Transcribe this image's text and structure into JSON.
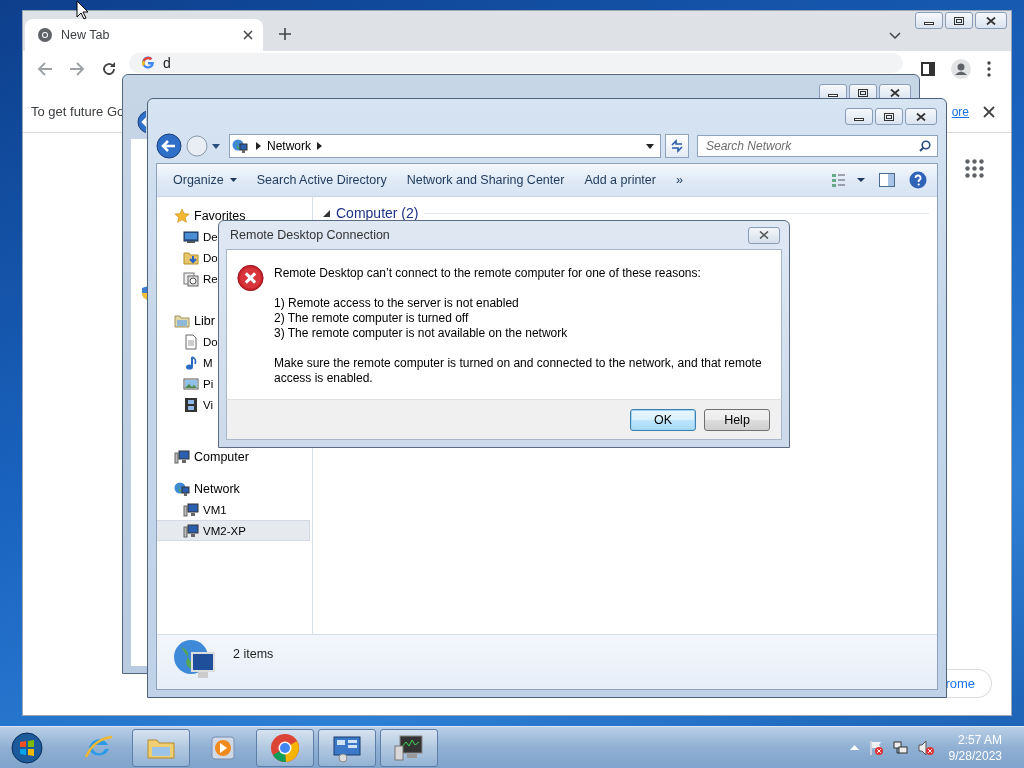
{
  "browser": {
    "tabs": [
      {
        "title": "New Tab",
        "selected": true
      }
    ],
    "omnibox": {
      "value": "d"
    },
    "infobar": {
      "message": "To get future Go",
      "link": "ore"
    },
    "page_button": "rome"
  },
  "explorer": {
    "address": {
      "crumbs": [
        "Network"
      ]
    },
    "search": {
      "placeholder": "Search Network"
    },
    "toolbar": [
      {
        "label": "Organize",
        "menu": true
      },
      {
        "label": "Search Active Directory",
        "menu": false
      },
      {
        "label": "Network and Sharing Center",
        "menu": false
      },
      {
        "label": "Add a printer",
        "menu": false
      },
      {
        "label": "»",
        "menu": false
      }
    ],
    "nav": [
      {
        "label": "Favorites",
        "kind": "favorites",
        "selected": false,
        "children": [
          {
            "label": "De",
            "kind": "desktop",
            "selected": false
          },
          {
            "label": "Do",
            "kind": "downloads",
            "selected": false
          },
          {
            "label": "Re",
            "kind": "recent",
            "selected": false
          }
        ]
      },
      {
        "label": "Libr",
        "kind": "libraries",
        "selected": false,
        "children": [
          {
            "label": "Do",
            "kind": "documents",
            "selected": false
          },
          {
            "label": "M",
            "kind": "music",
            "selected": false
          },
          {
            "label": "Pi",
            "kind": "pictures",
            "selected": false
          },
          {
            "label": "Vi",
            "kind": "videos",
            "selected": false
          }
        ]
      },
      {
        "label": "Computer",
        "kind": "computer",
        "selected": false
      },
      {
        "label": "Network",
        "kind": "network",
        "selected": false,
        "children": [
          {
            "label": "VM1",
            "kind": "pc",
            "selected": false
          },
          {
            "label": "VM2-XP",
            "kind": "pc",
            "selected": true
          }
        ]
      }
    ],
    "group": {
      "title": "Computer (2)",
      "expanded": true
    },
    "status": "2 items"
  },
  "dialog": {
    "title": "Remote Desktop Connection",
    "message": "Remote Desktop can’t connect to the remote computer for one of these reasons:",
    "reasons": [
      "1) Remote access to the server is not enabled",
      "2) The remote computer is turned off",
      "3) The remote computer is not available on the network"
    ],
    "advice": "Make sure the remote computer is turned on and connected to the network, and that remote access is enabled.",
    "buttons": [
      {
        "label": "OK",
        "default": true
      },
      {
        "label": "Help",
        "default": false
      }
    ]
  },
  "taskbar": {
    "apps": [
      {
        "kind": "ie",
        "running": false
      },
      {
        "kind": "explorer",
        "running": true
      },
      {
        "kind": "media",
        "running": false
      },
      {
        "kind": "chrome",
        "running": true
      },
      {
        "kind": "control",
        "running": true
      },
      {
        "kind": "rdp",
        "running": true
      }
    ],
    "clock": {
      "time": "2:57 AM",
      "date": "9/28/2023"
    }
  }
}
